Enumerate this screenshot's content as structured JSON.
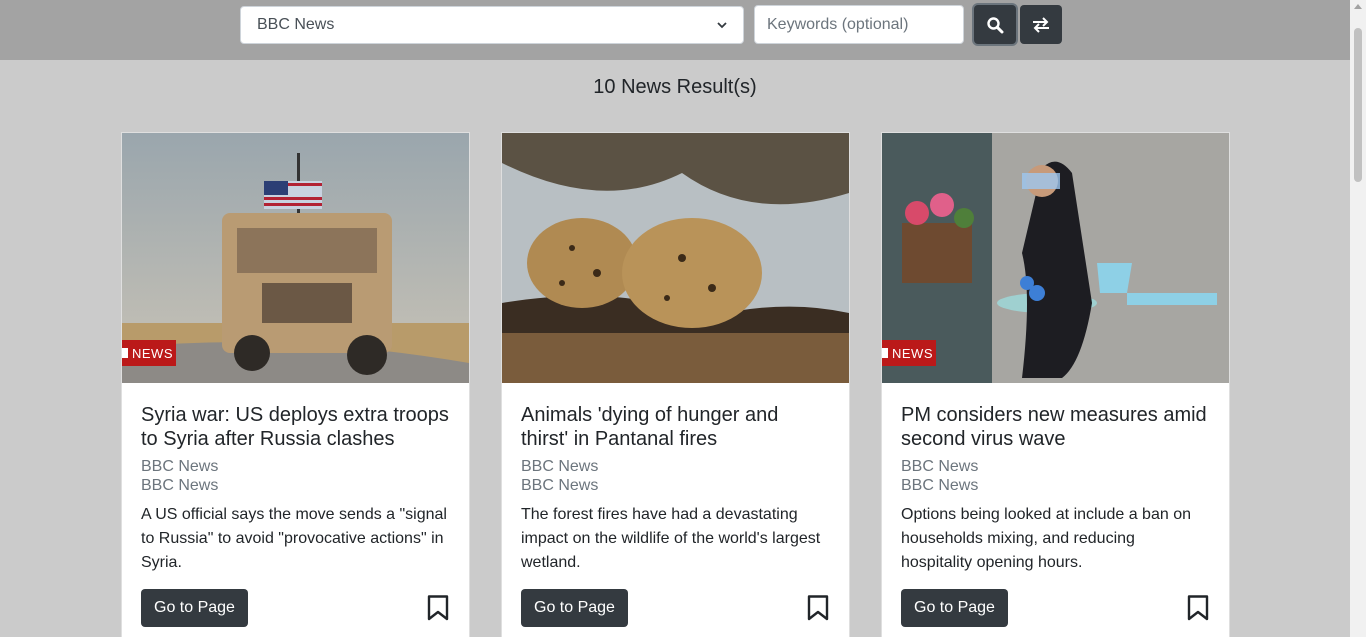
{
  "search": {
    "source_selected": "BBC News",
    "keywords_placeholder": "Keywords (optional)",
    "search_icon": "search-icon",
    "swap_icon": "swap-arrows-icon"
  },
  "results": {
    "title": "10 News Result(s)"
  },
  "cards": [
    {
      "title": "Syria war: US deploys extra troops to Syria after Russia clashes",
      "source": "BBC News",
      "author": "BBC News",
      "description": "A US official says the move sends a \"signal to Russia\" to avoid \"provocative actions\" in Syria.",
      "button": "Go to Page",
      "badge": "NEWS"
    },
    {
      "title": "Animals 'dying of hunger and thirst' in Pantanal fires",
      "source": "BBC News",
      "author": "BBC News",
      "description": "The forest fires have had a devastating impact on the wildlife of the world's largest wetland.",
      "button": "Go to Page",
      "badge": ""
    },
    {
      "title": "PM considers new measures amid second virus wave",
      "source": "BBC News",
      "author": "BBC News",
      "description": "Options being looked at include a ban on households mixing, and reducing hospitality opening hours.",
      "button": "Go to Page",
      "badge": "NEWS"
    }
  ],
  "colors": {
    "page_bg": "#cbcbcb",
    "topbar_bg": "#a3a3a3",
    "button_dark": "#343a40",
    "badge_red": "#bb1919"
  }
}
